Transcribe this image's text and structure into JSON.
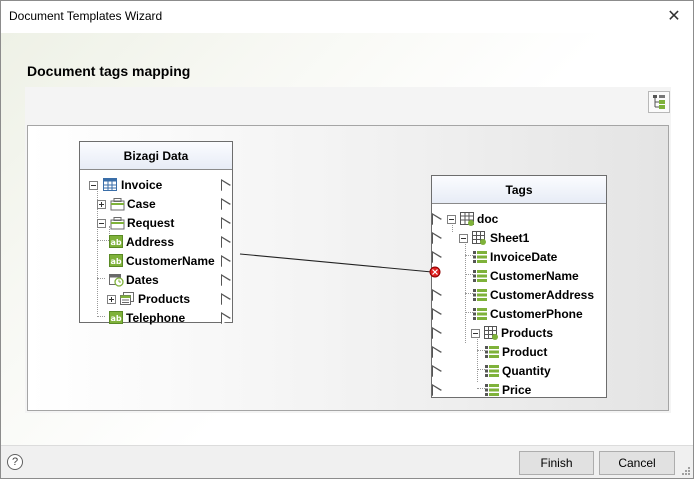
{
  "window": {
    "title": "Document Templates Wizard",
    "close_symbol": "✕"
  },
  "page": {
    "heading": "Document tags mapping"
  },
  "toolbar": {
    "layout_icon": "tree-layout-icon"
  },
  "left_box": {
    "title": "Bizagi Data",
    "items": [
      {
        "label": "Invoice",
        "icon": "entity-table-icon"
      },
      {
        "label": "Case",
        "icon": "case-folder-icon"
      },
      {
        "label": "Request",
        "icon": "case-folder-icon"
      },
      {
        "label": "Address",
        "icon": "ab-text-icon"
      },
      {
        "label": "CustomerName",
        "icon": "ab-text-icon"
      },
      {
        "label": "Dates",
        "icon": "calendar-clock-icon"
      },
      {
        "label": "Products",
        "icon": "collection-icon"
      },
      {
        "label": "Telephone",
        "icon": "ab-text-icon"
      }
    ]
  },
  "right_box": {
    "title": "Tags",
    "items": [
      {
        "label": "doc",
        "icon": "doc-table-icon"
      },
      {
        "label": "Sheet1",
        "icon": "sheet-icon"
      },
      {
        "label": "InvoiceDate",
        "icon": "field-tag-icon"
      },
      {
        "label": "CustomerName",
        "icon": "field-tag-icon"
      },
      {
        "label": "CustomerAddress",
        "icon": "field-tag-icon"
      },
      {
        "label": "CustomerPhone",
        "icon": "field-tag-icon"
      },
      {
        "label": "Products",
        "icon": "sheet-icon"
      },
      {
        "label": "Product",
        "icon": "field-tag-icon"
      },
      {
        "label": "Quantity",
        "icon": "field-tag-icon"
      },
      {
        "label": "Price",
        "icon": "field-tag-icon"
      }
    ]
  },
  "mapping": {
    "from": "CustomerName",
    "to": "CustomerName"
  },
  "footer": {
    "help": "?",
    "finish_label": "Finish",
    "cancel_label": "Cancel"
  },
  "colors": {
    "link_line": "#222222",
    "mapped_port": "#e02020",
    "icon_green": "#7fb23a",
    "icon_blue": "#3a6ea8"
  }
}
